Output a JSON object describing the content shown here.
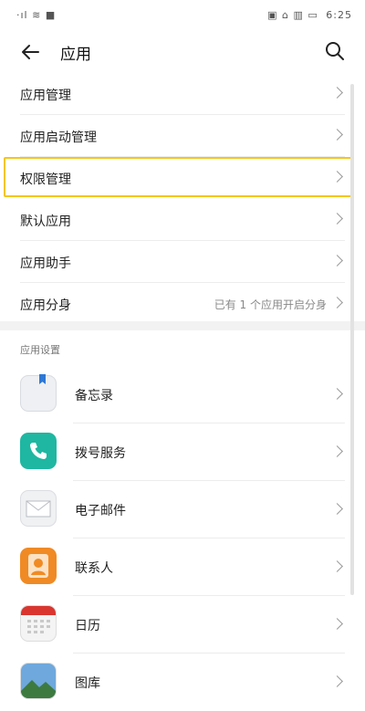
{
  "status_bar": {
    "left": "·ıl ≋ ■",
    "right": "▣ ⌂ ▥ ▭",
    "time": "6:25"
  },
  "header": {
    "title": "应用",
    "back_icon": "arrow-left-icon",
    "search_icon": "search-icon"
  },
  "menu": [
    {
      "label": "应用管理",
      "value": ""
    },
    {
      "label": "应用启动管理",
      "value": ""
    },
    {
      "label": "权限管理",
      "value": ""
    },
    {
      "label": "默认应用",
      "value": ""
    },
    {
      "label": "应用助手",
      "value": ""
    },
    {
      "label": "应用分身",
      "value": "已有 1 个应用开启分身"
    }
  ],
  "section_title": "应用设置",
  "apps": [
    {
      "name": "备忘录",
      "icon": "memo-icon"
    },
    {
      "name": "拨号服务",
      "icon": "phone-icon"
    },
    {
      "name": "电子邮件",
      "icon": "mail-icon"
    },
    {
      "name": "联系人",
      "icon": "contacts-icon"
    },
    {
      "name": "日历",
      "icon": "calendar-icon"
    },
    {
      "name": "图库",
      "icon": "gallery-icon"
    }
  ],
  "colors": {
    "highlight": "#f5c518",
    "phone_icon": "#1fb7a1",
    "contacts_icon": "#f08a24",
    "calendar_header": "#d9362f"
  }
}
